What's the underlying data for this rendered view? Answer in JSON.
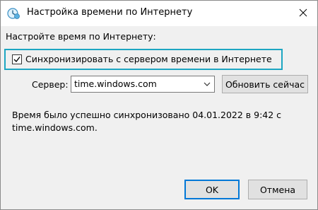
{
  "window": {
    "title": "Настройка времени по Интернету",
    "app_icon": "clock-globe-icon",
    "close_icon": "close-icon"
  },
  "dialog": {
    "section_label": "Настройте время по Интернету:",
    "sync_checkbox": {
      "label": "Синхронизировать с сервером времени в Интернете",
      "checked": true,
      "highlight_color": "#1da6c2"
    },
    "server": {
      "label": "Сервер:",
      "value": "time.windows.com"
    },
    "update_button": "Обновить сейчас",
    "status_line1": "Время было успешно синхронизовано 04.01.2022 в 9:42 с",
    "status_line2": "time.windows.com.",
    "ok_button": "OK",
    "cancel_button": "Отмена",
    "accent_color": "#0078d7"
  }
}
